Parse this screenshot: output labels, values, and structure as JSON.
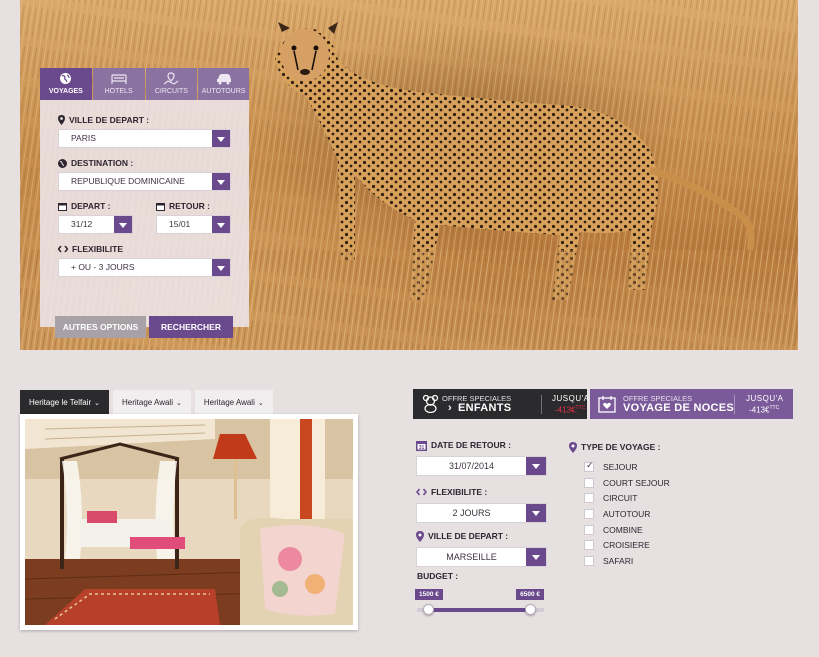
{
  "search": {
    "tabs": [
      {
        "label": "VOYAGES",
        "icon": "globe-icon",
        "active": true
      },
      {
        "label": "HOTELS",
        "icon": "bed-icon",
        "active": false
      },
      {
        "label": "CIRCUITS",
        "icon": "map-pin-route-icon",
        "active": false
      },
      {
        "label": "AUTOTOURS",
        "icon": "car-icon",
        "active": false
      }
    ],
    "departure_city_label": "VILLE DE DEPART :",
    "departure_city_value": "PARIS",
    "destination_label": "DESTINATION :",
    "destination_value": "REPUBLIQUE DOMINICAINE",
    "depart_label": "DEPART :",
    "depart_value": "31/12",
    "retour_label": "RETOUR :",
    "retour_value": "15/01",
    "flexibility_label": "FLEXIBILITE",
    "flexibility_value": "+ OU - 3 JOURS",
    "other_options_button": "AUTRES OPTIONS",
    "search_button": "RECHERCHER"
  },
  "hotels": {
    "tabs": [
      {
        "label": "Heritage le Telfair",
        "active": true
      },
      {
        "label": "Heritage Awali",
        "active": false
      },
      {
        "label": "Heritage Awali",
        "active": false
      }
    ]
  },
  "offers": {
    "kids": {
      "small": "OFFRE SPECIALES",
      "big": "ENFANTS",
      "arrow": "›",
      "jusqua": "JUSQU'A",
      "price": "-413€",
      "price_sup": "TTC",
      "price_color": "#e8344a"
    },
    "noces": {
      "small": "OFFRE SPECIALES",
      "big": "VOYAGE DE NOCES",
      "jusqua": "JUSQU'A",
      "price": "-413€",
      "price_sup": "TTC"
    }
  },
  "filters": {
    "return_date_label": "DATE DE RETOUR :",
    "return_date_value": "31/07/2014",
    "flexibility_label": "FLEXIBILITE :",
    "flexibility_value": "2 JOURS",
    "departure_city_label": "VILLE DE DEPART :",
    "departure_city_value": "MARSEILLE",
    "budget_label": "BUDGET :",
    "budget_min": "1500 €",
    "budget_max": "6500 €",
    "type_label": "TYPE DE VOYAGE :",
    "types": [
      {
        "label": "SEJOUR",
        "checked": true
      },
      {
        "label": "COURT SEJOUR",
        "checked": false
      },
      {
        "label": "CIRCUIT",
        "checked": false
      },
      {
        "label": "AUTOTOUR",
        "checked": false
      },
      {
        "label": "COMBINE",
        "checked": false
      },
      {
        "label": "CROISIERE",
        "checked": false
      },
      {
        "label": "SAFARI",
        "checked": false
      }
    ]
  },
  "colors": {
    "accent": "#6a4a8c",
    "dark": "#2b2a2c",
    "background": "#e7e0e1"
  }
}
